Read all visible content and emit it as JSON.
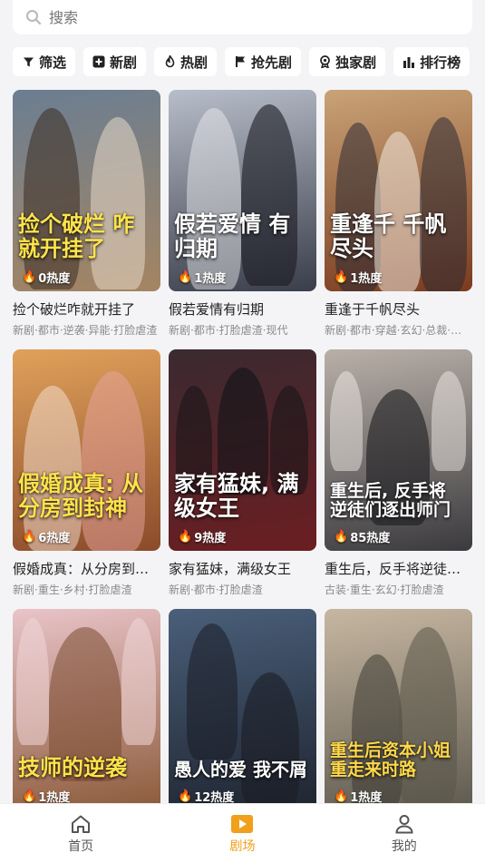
{
  "search": {
    "placeholder": "搜索"
  },
  "filters": [
    {
      "label": "筛选",
      "icon": "funnel-icon"
    },
    {
      "label": "新剧",
      "icon": "plus-box-icon"
    },
    {
      "label": "热剧",
      "icon": "flame-icon"
    },
    {
      "label": "抢先剧",
      "icon": "flag-icon"
    },
    {
      "label": "独家剧",
      "icon": "badge-icon"
    },
    {
      "label": "排行榜",
      "icon": "bar-chart-icon"
    }
  ],
  "dramas": [
    {
      "poster_text": "捡个破烂 咋就开挂了",
      "heat": "0热度",
      "title": "捡个破烂咋就开挂了",
      "tags": "新剧·都市·逆袭·异能·打脸虐渣",
      "colors": [
        "#6b7e92",
        "#a48562"
      ]
    },
    {
      "poster_text": "假若爱情 有归期",
      "heat": "1热度",
      "title": "假若爱情有归期",
      "tags": "新剧·都市·打脸虐渣·现代",
      "colors": [
        "#b7bdc9",
        "#3a3d4a"
      ]
    },
    {
      "poster_text": "重逢千 千帆尽头",
      "heat": "1热度",
      "title": "重逢于千帆尽头",
      "tags": "新剧·都市·穿越·玄幻·总裁·打脸虐渣",
      "colors": [
        "#c9a377",
        "#7a3b1f"
      ]
    },
    {
      "poster_text": "假婚成真: 从分房到封神",
      "heat": "6热度",
      "title": "假婚成真：从分房到封神",
      "tags": "新剧·重生·乡村·打脸虐渣",
      "colors": [
        "#e0a15b",
        "#8b4b2b"
      ]
    },
    {
      "poster_text": "家有猛妹, 满级女王",
      "heat": "9热度",
      "title": "家有猛妹，满级女王",
      "tags": "新剧·都市·打脸虐渣",
      "colors": [
        "#3a2a30",
        "#6b1e22"
      ]
    },
    {
      "poster_text": "重生后, 反手将 逆徒们逐出师门",
      "heat": "85热度",
      "title": "重生后，反手将逆徒们逐出师门",
      "tags": "古装·重生·玄幻·打脸虐渣",
      "colors": [
        "#b9b0a8",
        "#3b3a3e"
      ]
    },
    {
      "poster_text": "技师的逆袭",
      "heat": "1热度",
      "title": "",
      "tags": "",
      "colors": [
        "#e9c4c9",
        "#8c5a3a"
      ]
    },
    {
      "poster_text": "愚人的爱 我不屑",
      "heat": "12热度",
      "title": "",
      "tags": "",
      "colors": [
        "#4a5f7a",
        "#1f2530"
      ]
    },
    {
      "poster_text": "重生后资本小姐 重走来时路",
      "heat": "1热度",
      "title": "",
      "tags": "",
      "colors": [
        "#c7b7a1",
        "#5e5a50"
      ]
    }
  ],
  "tabbar": [
    {
      "label": "首页",
      "icon": "home-icon",
      "active": false
    },
    {
      "label": "剧场",
      "icon": "play-icon",
      "active": true
    },
    {
      "label": "我的",
      "icon": "profile-icon",
      "active": false
    }
  ],
  "colors": {
    "accent": "#f0a01a",
    "page_bg": "#f4f4f6",
    "card_bg": "#ffffff"
  }
}
